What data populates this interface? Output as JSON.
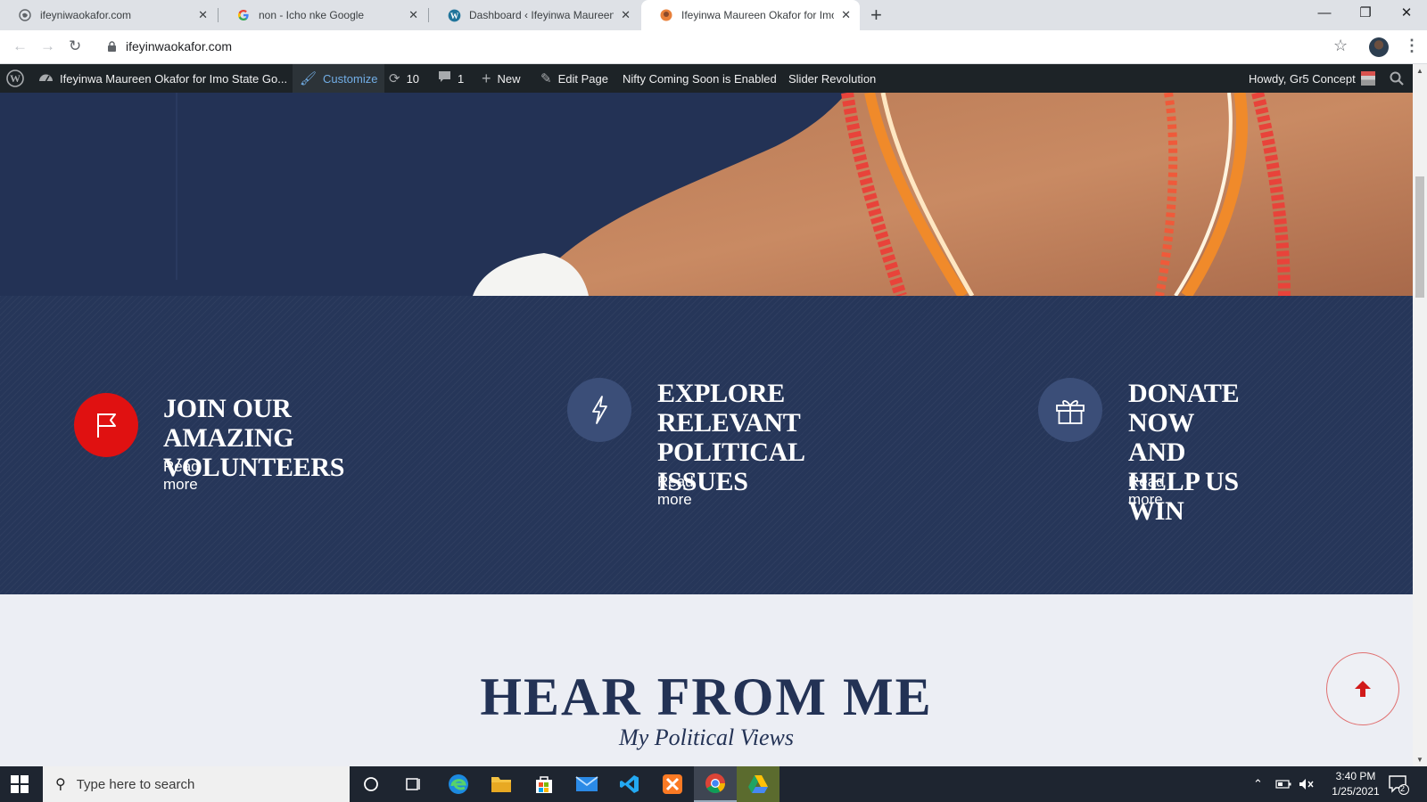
{
  "browser": {
    "tabs": [
      {
        "title": "ifeyniwaokafor.com",
        "icon": "globe-icon",
        "active": false
      },
      {
        "title": "non - Icho nke Google",
        "icon": "google-icon",
        "active": false
      },
      {
        "title": "Dashboard ‹ Ifeyinwa Maureen Okafor",
        "icon": "wordpress-icon",
        "active": false
      },
      {
        "title": "Ifeyinwa Maureen Okafor for Imo State Governor",
        "icon": "site-favicon",
        "active": true
      }
    ],
    "url": "ifeyinwaokafor.com",
    "tab_close_glyph": "✕",
    "new_tab_glyph": "+"
  },
  "adminbar": {
    "site_name": "Ifeyinwa Maureen Okafor for Imo State Go...",
    "customize": "Customize",
    "updates_count": "10",
    "comments_count": "1",
    "new_label": "New",
    "edit_page": "Edit Page",
    "coming_soon": "Nifty Coming Soon is Enabled",
    "slider": "Slider Revolution",
    "howdy": "Howdy, Gr5 Concept"
  },
  "features": [
    {
      "title_lines": [
        "JOIN OUR AMAZING",
        "VOLUNTEERS"
      ],
      "link": "Read more",
      "icon": "flag-icon",
      "color": "#e01111"
    },
    {
      "title_lines": [
        "EXPLORE",
        "RELEVANT",
        "POLITICAL ISSUES"
      ],
      "link": "Read more",
      "icon": "lightning-icon",
      "color": "#3b4e78"
    },
    {
      "title_lines": [
        "DONATE NOW",
        "AND HELP US",
        "WIN"
      ],
      "link": "Read more",
      "icon": "gift-icon",
      "color": "#3b4e78"
    }
  ],
  "section": {
    "heading": "HEAR FROM ME",
    "subheading": "My Political Views"
  },
  "taskbar": {
    "search_placeholder": "Type here to search",
    "time": "3:40 PM",
    "date": "1/25/2021",
    "notification_count": "2"
  },
  "colors": {
    "navy": "#233255",
    "accent_red": "#e01111",
    "admin_bar": "#1d2327"
  }
}
